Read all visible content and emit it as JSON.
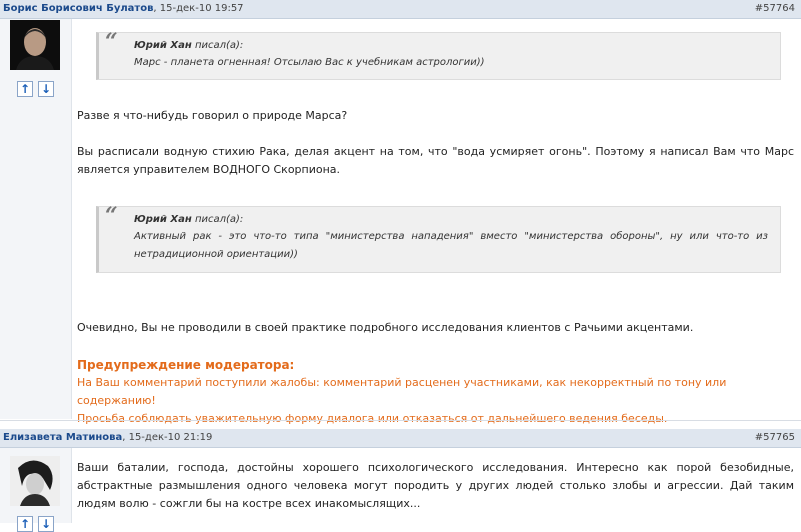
{
  "post1": {
    "author": "Борис Борисович Булатов",
    "date": ", 15-дек-10 19:57",
    "number": "#57764",
    "vote_up": "↑",
    "vote_down": "↓",
    "quote1": {
      "author": "Юрий Хан",
      "wrote": " писал(а):",
      "text": "Марс - планета огненная! Отсылаю Вас к учебникам астрологии))"
    },
    "para1": "Разве я что-нибудь говорил о природе Марса?",
    "para2": "Вы расписали водную стихию Рака, делая акцент на том, что \"вода усмиряет огонь\". Поэтому я написал Вам что Марс является управителем ВОДНОГО Скорпиона.",
    "quote2": {
      "author": "Юрий Хан",
      "wrote": " писал(а):",
      "text": "Активный рак - это что-то типа \"министерства нападения\" вместо \"министерства обороны\", ну или что-то из нетрадиционной ориентации))"
    },
    "para3": "Очевидно, Вы не проводили в своей практике подробного исследования клиентов с Рачьими акцентами.",
    "moderator": {
      "title": "Предупреждение модератора:",
      "line1": "На Ваш комментарий поступили жалобы: комментарий расценен участниками, как некорректный по тону или содержанию!",
      "line2": "Просьба соблюдать уважительную форму диалога или отказаться от дальнейшего ведения беседы."
    }
  },
  "post2": {
    "author": "Елизавета Матинова",
    "date": ", 15-дек-10 21:19",
    "number": "#57765",
    "text": "Ваши баталии, господа, достойны хорошего психологического исследования. Интересно как порой безобидные, абстрактные размышления одного человека могут породить у других людей столько злобы и агрессии. Дай таким людям волю - сожгли бы на костре всех инакомыслящих..."
  }
}
